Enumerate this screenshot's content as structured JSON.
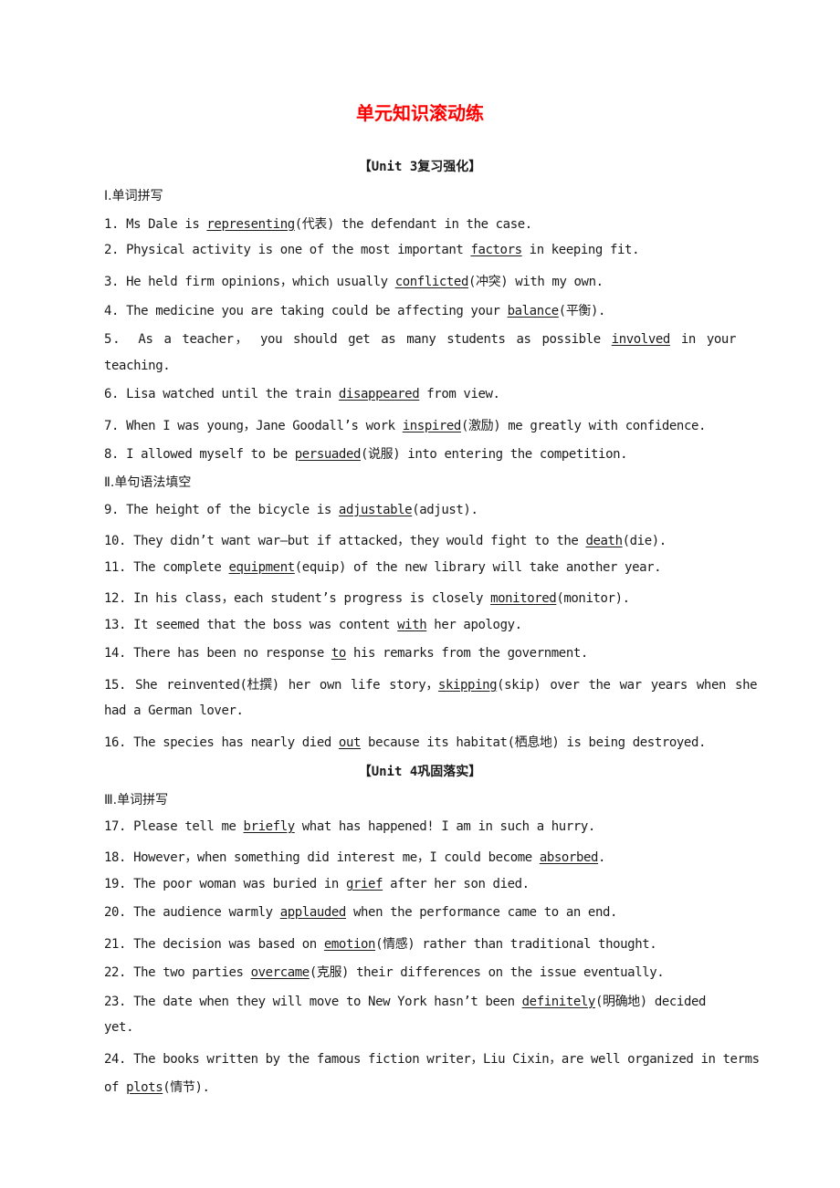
{
  "title": "单元知识滚动练",
  "title_color": "#ff0000",
  "units": [
    {
      "heading": "【Unit 3复习强化】",
      "sections": [
        {
          "heading": "Ⅰ.单词拼写",
          "items": [
            {
              "pre": "1. Ms Dale is ",
              "answer": "representing",
              "post": "(代表) the defendant in the case."
            },
            {
              "pre": "2. Physical activity is one of the most important ",
              "answer": "factors",
              "post": " in keeping fit."
            },
            {
              "pre": "3. He held firm opinions，which usually ",
              "answer": "conflicted",
              "post": "(冲突) with my own."
            },
            {
              "pre": "4. The medicine you are taking could be affecting your ",
              "answer": "balance",
              "post": "(平衡)."
            },
            {
              "pre": "5． As a teacher， you should get as many students as possible ",
              "answer": "involved",
              "post": " in your",
              "cont": "teaching."
            },
            {
              "pre": "6. Lisa watched until the train ",
              "answer": "disappeared",
              "post": " from view."
            },
            {
              "pre": "7. When I was young，Jane Goodall’s work ",
              "answer": "inspired",
              "post": "(激励) me greatly with confidence."
            },
            {
              "pre": "8. I allowed myself to be ",
              "answer": "persuaded",
              "post": "(说服) into entering the competition."
            }
          ]
        },
        {
          "heading": "Ⅱ.单句语法填空",
          "items": [
            {
              "pre": "9. The height of the bicycle is ",
              "answer": "adjustable",
              "post": "(adjust)."
            },
            {
              "pre": "10. They didn’t want war—but if attacked，they would fight to the ",
              "answer": "death",
              "post": "(die)."
            },
            {
              "pre": "11. The complete ",
              "answer": "equipment",
              "post": "(equip) of the new library will take another year."
            },
            {
              "pre": "12. In his class，each student’s progress is closely ",
              "answer": "monitored",
              "post": "(monitor)."
            },
            {
              "pre": "13. It seemed that the boss was content ",
              "answer": "with",
              "post": " her apology."
            },
            {
              "pre": "14. There has been no response ",
              "answer": "to",
              "post": " his remarks from the government."
            },
            {
              "pre": "15. She reinvented(杜撰) her own life story，",
              "answer": "skipping",
              "post": "(skip) over the war years when she",
              "cont": "had a German lover."
            },
            {
              "pre": "16. The species has nearly died ",
              "answer": "out",
              "post": " because its habitat(栖息地) is being destroyed."
            }
          ]
        }
      ]
    },
    {
      "heading": "【Unit 4巩固落实】",
      "sections": [
        {
          "heading": "Ⅲ.单词拼写",
          "items": [
            {
              "pre": "17. Please tell me ",
              "answer": "briefly",
              "post": " what has happened! I am in such a hurry."
            },
            {
              "pre": "18. However，when something did interest me，I could become ",
              "answer": "absorbed",
              "post": "."
            },
            {
              "pre": "19. The poor woman was buried in ",
              "answer": "grief",
              "post": " after her son died."
            },
            {
              "pre": "20. The audience warmly ",
              "answer": "applauded",
              "post": " when the performance came to an end."
            },
            {
              "pre": "21. The decision was based on ",
              "answer": "emotion",
              "post": "(情感) rather than traditional thought."
            },
            {
              "pre": "22. The two parties ",
              "answer": "overcame",
              "post": "(克服) their differences on the issue eventually."
            },
            {
              "pre": "23. The date when they will move to New York hasn’t been ",
              "answer": "definitely",
              "post": "(明确地) decided",
              "cont": "yet."
            },
            {
              "pre": "24. The books written by the famous fiction writer，Liu Cixin，are well organized in terms",
              "answer": "",
              "post": "",
              "cont_pre": "of ",
              "cont_answer": "plots",
              "cont_post": "(情节)."
            }
          ]
        }
      ]
    }
  ]
}
